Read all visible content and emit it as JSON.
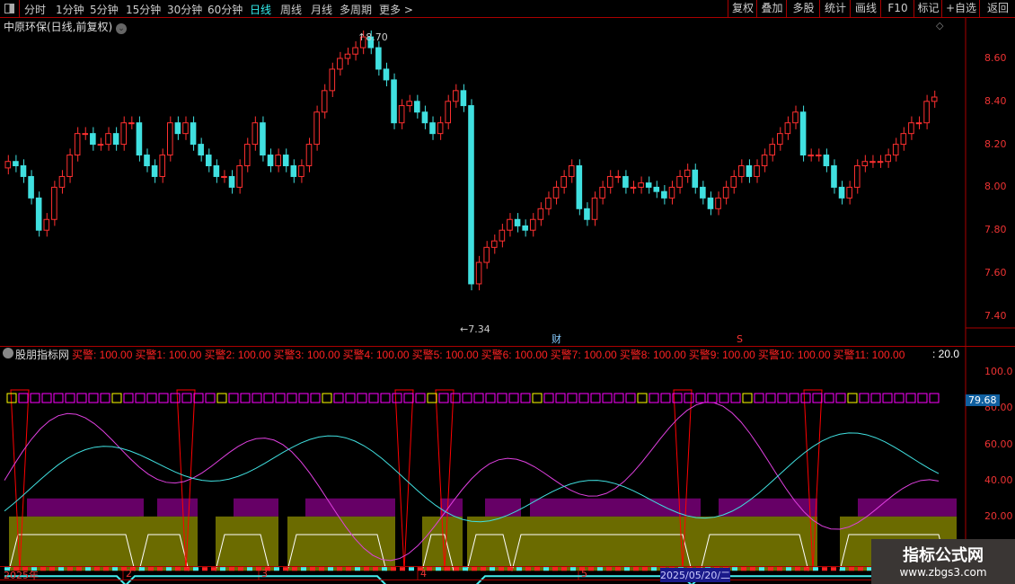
{
  "toolbar": {
    "tabs": [
      "分时",
      "1分钟",
      "5分钟",
      "15分钟",
      "30分钟",
      "60分钟",
      "日线",
      "周线",
      "月线",
      "多周期",
      "更多 >"
    ],
    "active": "日线",
    "buttons": [
      "复权",
      "叠加",
      "多股",
      "统计",
      "画线",
      "F10",
      "标记",
      "+自选",
      "返回"
    ]
  },
  "stock_title": "中原环保(日线,前复权)",
  "price_axis": [
    "8.60",
    "8.40",
    "8.20",
    "8.00",
    "7.80",
    "7.60",
    "7.40"
  ],
  "annotations": {
    "high": "8.70",
    "low": "7.34",
    "fin_marker": "财",
    "s_marker": "S"
  },
  "candles_close": [
    8.12,
    8.1,
    8.05,
    7.95,
    7.8,
    7.85,
    8.0,
    8.05,
    8.15,
    8.25,
    8.25,
    8.2,
    8.2,
    8.25,
    8.2,
    8.3,
    8.3,
    8.15,
    8.1,
    8.05,
    8.15,
    8.3,
    8.25,
    8.3,
    8.2,
    8.15,
    8.1,
    8.05,
    8.05,
    8.0,
    8.1,
    8.2,
    8.3,
    8.15,
    8.1,
    8.15,
    8.1,
    8.05,
    8.1,
    8.2,
    8.35,
    8.45,
    8.55,
    8.6,
    8.62,
    8.65,
    8.7,
    8.65,
    8.55,
    8.5,
    8.3,
    8.38,
    8.4,
    8.35,
    8.3,
    8.25,
    8.3,
    8.4,
    8.45,
    8.38,
    7.55,
    7.65,
    7.72,
    7.75,
    7.8,
    7.85,
    7.82,
    7.8,
    7.85,
    7.9,
    7.95,
    8.0,
    8.05,
    8.1,
    7.9,
    7.85,
    7.95,
    8.0,
    8.05,
    8.05,
    8.0,
    8.0,
    8.02,
    8.0,
    7.98,
    7.95,
    8.0,
    8.05,
    8.08,
    8.0,
    7.95,
    7.9,
    7.95,
    8.0,
    8.05,
    8.1,
    8.05,
    8.1,
    8.15,
    8.2,
    8.25,
    8.3,
    8.35,
    8.15,
    8.15,
    8.15,
    8.1,
    8.0,
    7.95,
    8.0,
    8.1,
    8.12,
    8.12,
    8.12,
    8.15,
    8.2,
    8.25,
    8.3,
    8.3,
    8.4,
    8.42
  ],
  "indicator": {
    "name": "股朋指标网",
    "values": [
      {
        "label": "买警",
        "value": "100.00"
      },
      {
        "label": "买警1",
        "value": "100.00"
      },
      {
        "label": "买警2",
        "value": "100.00"
      },
      {
        "label": "买警3",
        "value": "100.00"
      },
      {
        "label": "买警4",
        "value": "100.00"
      },
      {
        "label": "买警5",
        "value": "100.00"
      },
      {
        "label": "买警6",
        "value": "100.00"
      },
      {
        "label": "买警7",
        "value": "100.00"
      },
      {
        "label": "买警8",
        "value": "100.00"
      },
      {
        "label": "买警9",
        "value": "100.00"
      },
      {
        "label": "买警10",
        "value": "100.00"
      },
      {
        "label": "买警11",
        "value": "100.00"
      }
    ],
    "extra": ": 20.0",
    "axis": [
      "100.0",
      "80.00",
      "60.00",
      "40.00",
      "20.00"
    ],
    "current": "79.68"
  },
  "dates": [
    {
      "label": "2025年"
    },
    {
      "label": "2"
    },
    {
      "label": "3"
    },
    {
      "label": "4"
    },
    {
      "label": "5"
    },
    {
      "label": "2025/05/20/二",
      "highlight": true
    }
  ],
  "watermark": {
    "title": "指标公式网",
    "url": "www.zbgs3.com"
  }
}
